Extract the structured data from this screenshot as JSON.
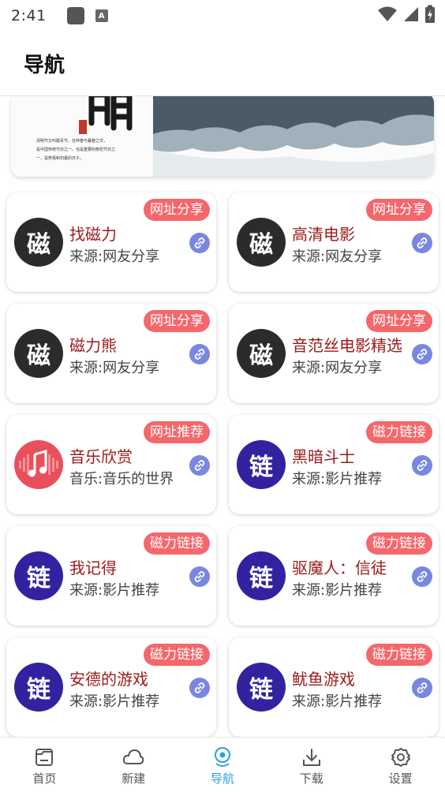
{
  "status": {
    "time": "2:41"
  },
  "appbar": {
    "title": "导航"
  },
  "banner": {
    "big_char": "明",
    "seal": "清明时节",
    "lines": [
      "清明节又叫踏青节，在仲春与暮春之交，",
      "是中国传统节日之一。也是重要的祭祀节日之",
      "一，是祭祖和扫墓的日子。"
    ]
  },
  "cards": [
    {
      "tag": "网址分享",
      "title": "找磁力",
      "subtitle": "来源:网友分享",
      "avatar_char": "磁",
      "avatar_color": "#2b2b2b"
    },
    {
      "tag": "网址分享",
      "title": "高清电影",
      "subtitle": "来源:网友分享",
      "avatar_char": "磁",
      "avatar_color": "#2b2b2b"
    },
    {
      "tag": "网址分享",
      "title": "磁力熊",
      "subtitle": "来源:网友分享",
      "avatar_char": "磁",
      "avatar_color": "#2b2b2b"
    },
    {
      "tag": "网址分享",
      "title": "音范丝电影精选",
      "subtitle": "来源:网友分享",
      "avatar_char": "磁",
      "avatar_color": "#2b2b2b"
    },
    {
      "tag": "网址推荐",
      "title": "音乐欣赏",
      "subtitle": "音乐:音乐的世界",
      "avatar_char": "music-note-icon",
      "avatar_color": "#e8505b"
    },
    {
      "tag": "磁力链接",
      "title": "黑暗斗士",
      "subtitle": "来源:影片推荐",
      "avatar_char": "链",
      "avatar_color": "#3322a0"
    },
    {
      "tag": "磁力链接",
      "title": "我记得",
      "subtitle": "来源:影片推荐",
      "avatar_char": "链",
      "avatar_color": "#3322a0"
    },
    {
      "tag": "磁力链接",
      "title": "驱魔人：信徒",
      "subtitle": "来源:影片推荐",
      "avatar_char": "链",
      "avatar_color": "#3322a0"
    },
    {
      "tag": "磁力链接",
      "title": "安德的游戏",
      "subtitle": "来源:影片推荐",
      "avatar_char": "链",
      "avatar_color": "#3322a0"
    },
    {
      "tag": "磁力链接",
      "title": "鱿鱼游戏",
      "subtitle": "来源:影片推荐",
      "avatar_char": "链",
      "avatar_color": "#3322a0"
    }
  ],
  "colors": {
    "tag_bg": "#f4676b",
    "title": "#9b1a1a",
    "link_icon": "#7888e0",
    "nav_active": "#2aa1dc"
  },
  "nav": [
    {
      "label": "首页",
      "icon": "home-icon"
    },
    {
      "label": "新建",
      "icon": "cloud-icon"
    },
    {
      "label": "导航",
      "icon": "navigation-pin-icon",
      "active": true
    },
    {
      "label": "下载",
      "icon": "download-icon"
    },
    {
      "label": "设置",
      "icon": "settings-gear-icon"
    }
  ]
}
